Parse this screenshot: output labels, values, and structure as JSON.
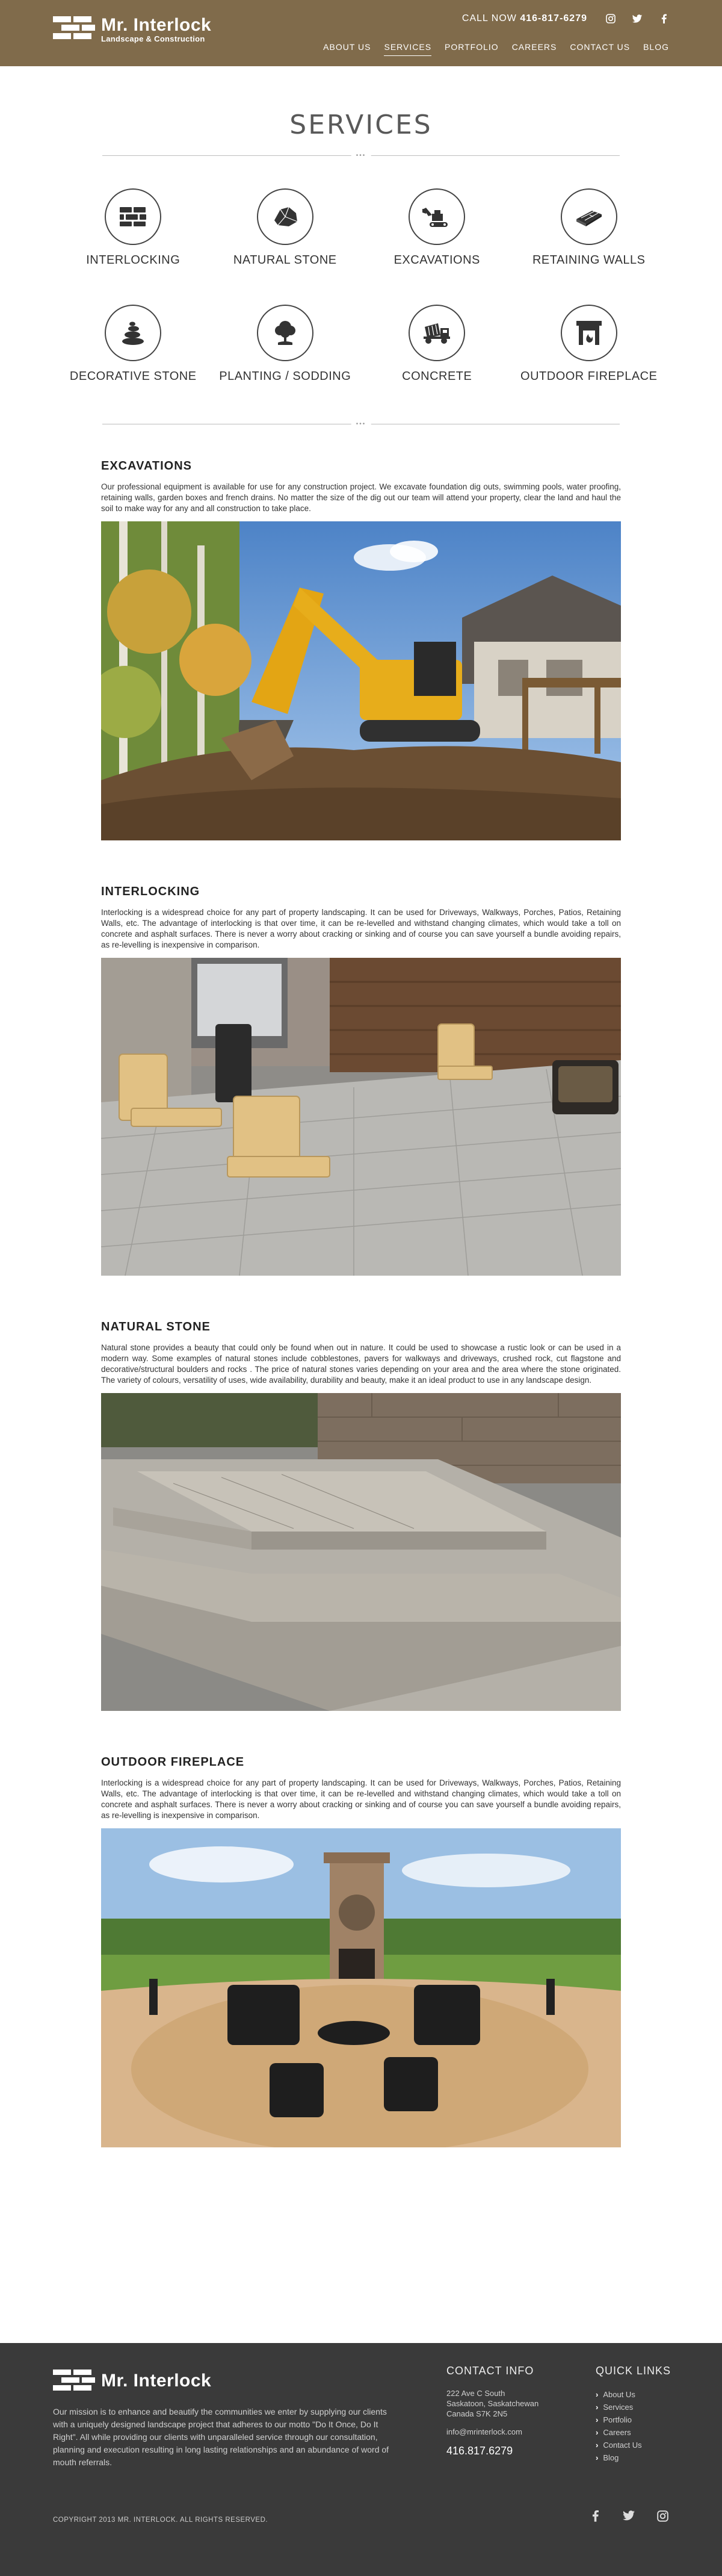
{
  "brand": {
    "name": "Mr. Interlock",
    "tagline": "Landscape & Construction"
  },
  "header": {
    "call_label": "CALL NOW",
    "call_number": "416-817-6279",
    "social": [
      "instagram-icon",
      "twitter-icon",
      "facebook-icon"
    ]
  },
  "nav": [
    {
      "label": "ABOUT US",
      "active": false
    },
    {
      "label": "SERVICES",
      "active": true
    },
    {
      "label": "PORTFOLIO",
      "active": false
    },
    {
      "label": "CAREERS",
      "active": false
    },
    {
      "label": "CONTACT US",
      "active": false
    },
    {
      "label": "BLOG",
      "active": false
    }
  ],
  "page": {
    "title": "SERVICES",
    "divider_dots": "•••"
  },
  "services": [
    {
      "label": "INTERLOCKING",
      "icon": "bricks-icon"
    },
    {
      "label": "NATURAL STONE",
      "icon": "stone-icon"
    },
    {
      "label": "EXCAVATIONS",
      "icon": "excavator-icon"
    },
    {
      "label": "RETAINING WALLS",
      "icon": "wall-block-icon"
    },
    {
      "label": "DECORATIVE STONE",
      "icon": "stacked-stones-icon"
    },
    {
      "label": "PLANTING / SODDING",
      "icon": "tree-icon"
    },
    {
      "label": "CONCRETE",
      "icon": "cement-mixer-icon"
    },
    {
      "label": "OUTDOOR FIREPLACE",
      "icon": "fireplace-icon"
    }
  ],
  "sections": [
    {
      "title": "EXCAVATIONS",
      "text": "Our professional equipment is available for use for any construction project. We excavate foundation dig outs, swimming pools, water proofing, retaining walls, garden boxes and french drains. No matter the size of the dig out our team will attend your property, clear the land and haul the soil to make way for any and all construction to take place."
    },
    {
      "title": "INTERLOCKING",
      "text": "Interlocking is a widespread choice for any part of property landscaping. It can be used for Driveways, Walkways, Porches, Patios, Retaining Walls, etc. The advantage of interlocking is that over time, it can be re-levelled and withstand changing climates, which would take a toll on concrete and asphalt surfaces. There is never a worry about cracking or sinking and of course you can save yourself a bundle avoiding repairs, as re-levelling is inexpensive in comparison."
    },
    {
      "title": "NATURAL STONE",
      "text": "Natural stone provides a beauty that could only be found when out in nature. It could be used to showcase a rustic look or can be used in a modern way. Some examples of natural stones include cobblestones, pavers for walkways and driveways, crushed rock, cut flagstone and decorative/structural boulders and rocks . The price of natural stones varies depending on your area and the area where the stone originated. The variety of colours, versatility of uses, wide availability, durability and beauty, make it an ideal product to use in any landscape design."
    },
    {
      "title": "OUTDOOR FIREPLACE",
      "text": "Interlocking is a widespread choice for any part of property landscaping. It can be used for Driveways, Walkways, Porches, Patios, Retaining Walls, etc. The advantage of interlocking is that over time, it can be re-levelled and withstand changing climates, which would take a toll on concrete and asphalt surfaces. There is never a worry about cracking or sinking and of course you can save yourself a bundle avoiding repairs, as re-levelling is inexpensive in comparison."
    }
  ],
  "footer": {
    "mission": "Our mission is to enhance and beautify the communities we enter by supplying our clients with a uniquely designed landscape project that adheres to our motto \"Do It Once, Do It Right\". All while providing our clients with unparalleled service through our consultation, planning and execution resulting in long lasting relationships and an abundance of word of mouth referrals.",
    "contact_heading": "CONTACT INFO",
    "address_line1": "222 Ave C South",
    "address_line2": "Saskatoon, Saskatchewan",
    "address_line3": "Canada S7K 2N5",
    "email": "info@mrinterlock.com",
    "phone": "416.817.6279",
    "links_heading": "QUICK LINKS",
    "links": [
      "About Us",
      "Services",
      "Portfolio",
      "Careers",
      "Contact Us",
      "Blog"
    ],
    "copyright": "COPYRIGHT 2013 MR. INTERLOCK. ALL RIGHTS RESERVED.",
    "social": [
      "facebook-icon",
      "twitter-icon",
      "instagram-icon"
    ]
  },
  "colors": {
    "header_bg": "#806b4b",
    "footer_bg": "#3a3a3a"
  }
}
